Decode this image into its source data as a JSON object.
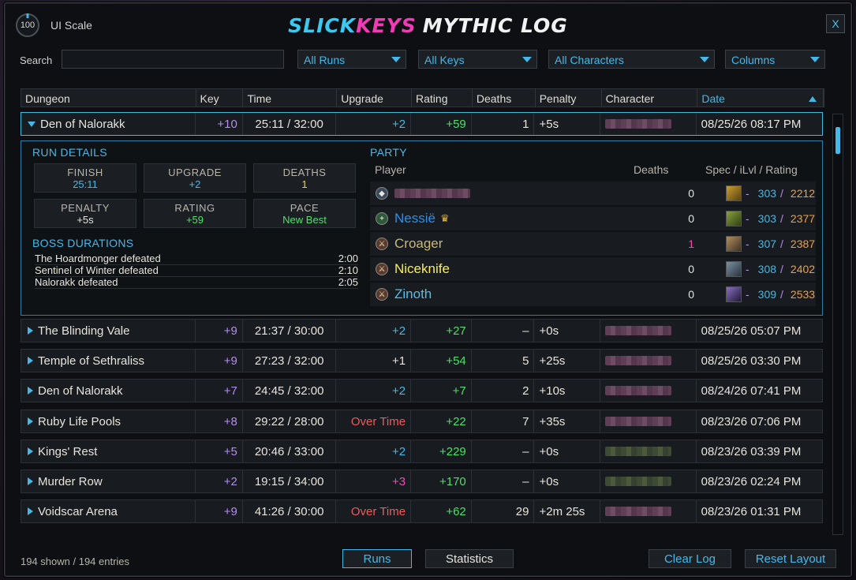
{
  "window": {
    "ui_scale_value": "100",
    "ui_scale_label": "UI Scale",
    "title_slick": "SLICK",
    "title_keys": "KEYS",
    "title_rest": "MYTHIC LOG",
    "close_label": "X"
  },
  "filters": {
    "search_label": "Search",
    "search_value": "",
    "runs": "All Runs",
    "keys": "All Keys",
    "characters": "All Characters",
    "columns": "Columns"
  },
  "columns": [
    "Dungeon",
    "Key",
    "Time",
    "Upgrade",
    "Rating",
    "Deaths",
    "Penalty",
    "Character",
    "Date"
  ],
  "expanded": {
    "dungeon": "Den of Nalorakk",
    "key": "+10",
    "time": "25:11 / 32:00",
    "upgrade": "+2",
    "rating": "+59",
    "deaths": "1",
    "penalty": "+5s",
    "date": "08/25/26 08:17 PM",
    "run_details_title": "RUN DETAILS",
    "stats": {
      "finish_label": "FINISH",
      "finish_value": "25:11",
      "upgrade_label": "UPGRADE",
      "upgrade_value": "+2",
      "deaths_label": "DEATHS",
      "deaths_value": "1",
      "penalty_label": "PENALTY",
      "penalty_value": "+5s",
      "rating_label": "RATING",
      "rating_value": "+59",
      "pace_label": "PACE",
      "pace_value": "New Best"
    },
    "boss_title": "BOSS DURATIONS",
    "bosses": [
      {
        "name": "The Hoardmonger defeated",
        "time": "2:00"
      },
      {
        "name": "Sentinel of Winter defeated",
        "time": "2:10"
      },
      {
        "name": "Nalorakk defeated",
        "time": "2:05"
      }
    ],
    "party_title": "PARTY",
    "party_headers": {
      "player": "Player",
      "deaths": "Deaths",
      "spec": "Spec / iLvl / Rating"
    },
    "party": [
      {
        "name": "",
        "deaths": "0",
        "ilvl": "303",
        "rating": "2212",
        "color": "#c8c8c8"
      },
      {
        "name": "Nessië",
        "deaths": "0",
        "ilvl": "303",
        "rating": "2377",
        "color": "#2f8fe8"
      },
      {
        "name": "Croager",
        "deaths": "1",
        "ilvl": "307",
        "rating": "2387",
        "color": "#c8b878"
      },
      {
        "name": "Niceknife",
        "deaths": "0",
        "ilvl": "308",
        "rating": "2402",
        "color": "#f8ec5a"
      },
      {
        "name": "Zinoth",
        "deaths": "0",
        "ilvl": "309",
        "rating": "2533",
        "color": "#4ec0ea"
      }
    ]
  },
  "runs": [
    {
      "dungeon": "The Blinding Vale",
      "key": "+9",
      "time": "21:37 / 30:00",
      "upgrade": "+2",
      "upgrade_class": "blue",
      "rating": "+27",
      "deaths": "–",
      "penalty": "+0s",
      "date": "08/25/26 05:07 PM",
      "char_color": "p"
    },
    {
      "dungeon": "Temple of Sethraliss",
      "key": "+9",
      "time": "27:23 / 32:00",
      "upgrade": "+1",
      "upgrade_class": "white",
      "rating": "+54",
      "deaths": "5",
      "penalty": "+25s",
      "date": "08/25/26 03:30 PM",
      "char_color": "p"
    },
    {
      "dungeon": "Den of Nalorakk",
      "key": "+7",
      "time": "24:45 / 32:00",
      "upgrade": "+2",
      "upgrade_class": "blue",
      "rating": "+7",
      "deaths": "2",
      "penalty": "+10s",
      "date": "08/24/26 07:41 PM",
      "char_color": "p"
    },
    {
      "dungeon": "Ruby Life Pools",
      "key": "+8",
      "time": "29:22 / 28:00",
      "upgrade": "Over Time",
      "upgrade_class": "red",
      "rating": "+22",
      "deaths": "7",
      "penalty": "+35s",
      "date": "08/23/26 07:06 PM",
      "char_color": "p"
    },
    {
      "dungeon": "Kings' Rest",
      "key": "+5",
      "time": "20:46 / 33:00",
      "upgrade": "+2",
      "upgrade_class": "blue",
      "rating": "+229",
      "deaths": "–",
      "penalty": "+0s",
      "date": "08/23/26 03:39 PM",
      "char_color": "g"
    },
    {
      "dungeon": "Murder Row",
      "key": "+2",
      "time": "19:15 / 34:00",
      "upgrade": "+3",
      "upgrade_class": "pink",
      "rating": "+170",
      "deaths": "–",
      "penalty": "+0s",
      "date": "08/23/26 02:24 PM",
      "char_color": "g"
    },
    {
      "dungeon": "Voidscar Arena",
      "key": "+9",
      "time": "41:26 / 30:00",
      "upgrade": "Over Time",
      "upgrade_class": "red",
      "rating": "+62",
      "deaths": "29",
      "penalty": "+2m 25s",
      "date": "08/23/26 01:31 PM",
      "char_color": "p"
    }
  ],
  "footer": {
    "count": "194 shown / 194 entries",
    "runs_tab": "Runs",
    "stats_tab": "Statistics",
    "clear_log": "Clear Log",
    "reset_layout": "Reset Layout"
  }
}
